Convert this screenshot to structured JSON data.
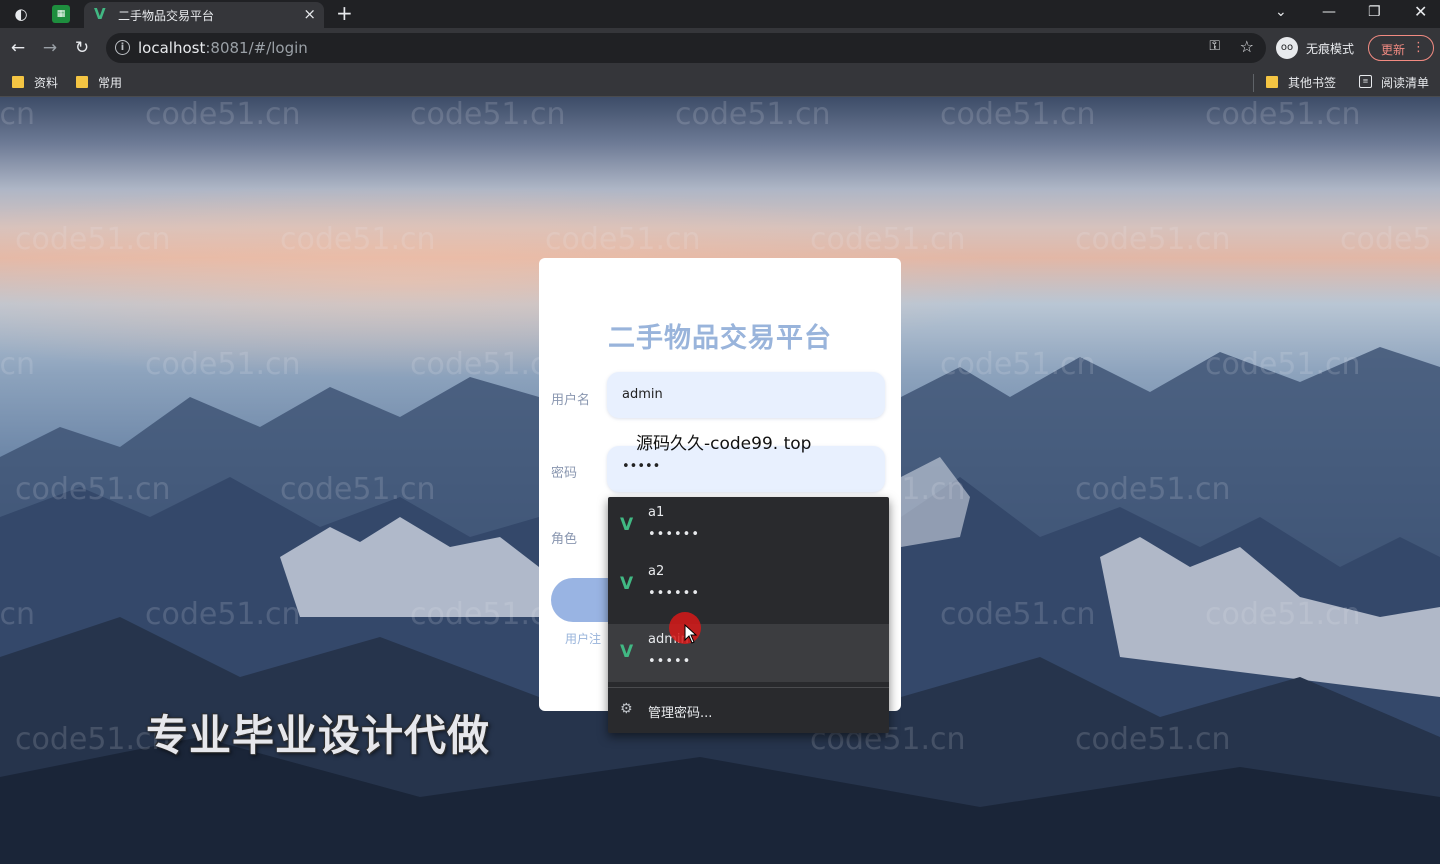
{
  "browser": {
    "tab_title": "二手物品交易平台",
    "new_tab": "+",
    "url_host": "localhost",
    "url_rest": ":8081/#/login",
    "incognito_label": "无痕模式",
    "update_label": "更新",
    "bookmarks": [
      "资料",
      "常用"
    ],
    "bookmarks_right": [
      "其他书签",
      "阅读清单"
    ]
  },
  "login": {
    "title": "二手物品交易平台",
    "username_label": "用户名",
    "username_value": "admin",
    "password_label": "密码",
    "password_value": "•••••",
    "role_label": "角色",
    "register_link": "用户注"
  },
  "autofill": {
    "items": [
      {
        "user": "a1",
        "pass": "••••••"
      },
      {
        "user": "a2",
        "pass": "••••••"
      },
      {
        "user": "admin",
        "pass": "•••••"
      }
    ],
    "manage_label": "管理密码..."
  },
  "overlay": {
    "source_text": "源码久久-code99. top",
    "promo_text": "专业毕业设计代做"
  },
  "watermark": "code51.cn",
  "colors": {
    "accent": "#99b4db",
    "input_bg": "#e8f0fe",
    "autofill_bg": "#292a2d"
  }
}
